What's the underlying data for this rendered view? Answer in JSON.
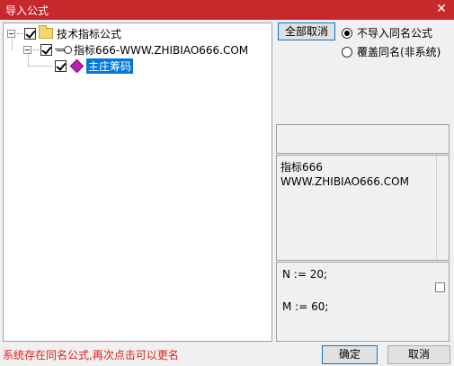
{
  "window": {
    "title": "导入公式",
    "close_glyph": "✕"
  },
  "tree": {
    "root": {
      "label": "技术指标公式",
      "checked": true
    },
    "child": {
      "label": "指标666-WWW.ZHIBIAO666.COM",
      "checked": true
    },
    "leaf": {
      "label": "主庄筹码",
      "checked": true,
      "selected": true
    }
  },
  "buttons": {
    "deselect_all": "全部取消",
    "ok": "确定",
    "cancel": "取消"
  },
  "options": {
    "no_import_same": "不导入同名公式",
    "overwrite_same": "覆盖同名(非系统)",
    "selected": "no_import_same"
  },
  "description": {
    "line1": "指标666",
    "line2": "WWW.ZHIBIAO666.COM"
  },
  "params": {
    "line1": "N := 20;",
    "line2": "M := 60;"
  },
  "status_text": "系统存在同名公式,再次点击可以更名",
  "colors": {
    "title_bar": "#c7282c",
    "selection": "#0078d7",
    "status": "#e0211b"
  }
}
